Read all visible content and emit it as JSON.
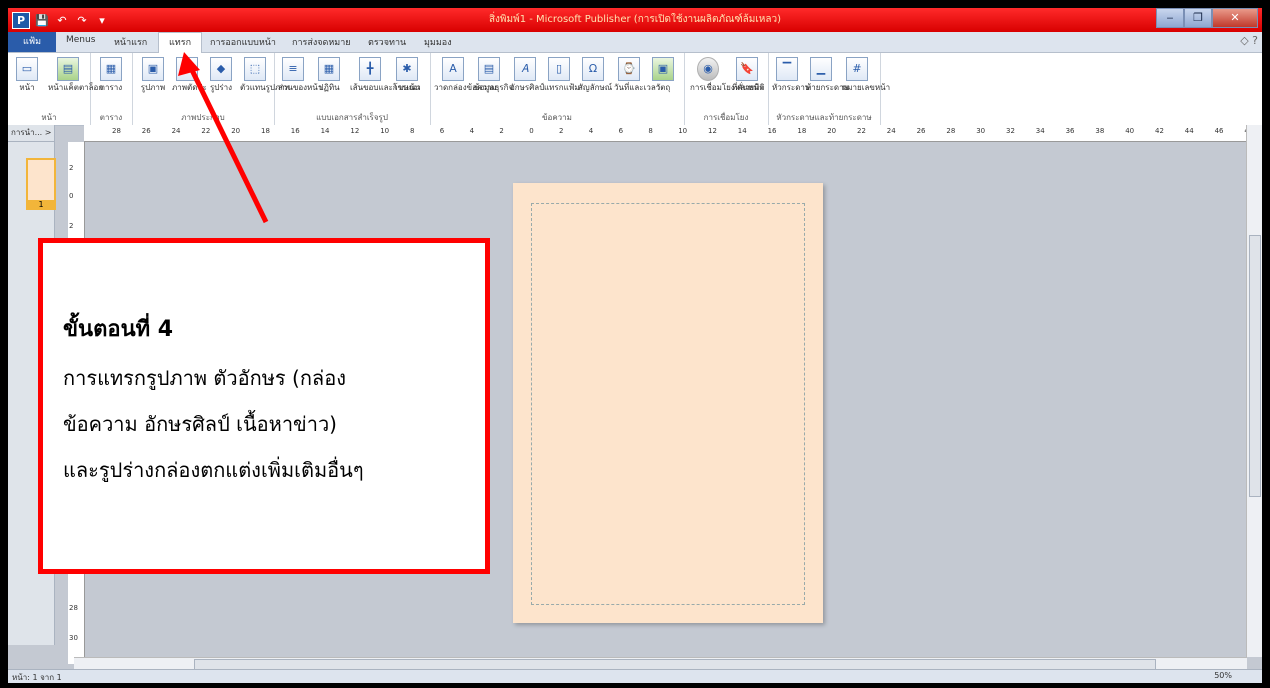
{
  "window": {
    "title": "สิ่งพิมพ์1 - Microsoft Publisher (การเปิดใช้งานผลิตภัณฑ์ล้มเหลว)",
    "minimize_icon": "minimize-icon",
    "maximize_icon": "maximize-icon",
    "close_icon": "close-icon",
    "minimize_label": "‒",
    "maximize_label": "❐",
    "close_label": "✕"
  },
  "quick_access": {
    "app_icon": "P",
    "save": "💾",
    "undo": "↶",
    "redo": "↷",
    "more": "▾"
  },
  "tabs": {
    "file": "แฟ้ม",
    "menus": "Menus",
    "home": "หน้าแรก",
    "insert": "แทรก",
    "page_design": "การออกแบบหน้า",
    "mailings": "การส่งจดหมาย",
    "review": "ตรวจทาน",
    "view": "มุมมอง"
  },
  "ribbon": {
    "groups": {
      "pages": {
        "name": "หน้า",
        "items": {
          "page": "หน้า",
          "catalog": "หน้าแค็ตตาล็อก"
        }
      },
      "tables": {
        "name": "ตาราง",
        "items": {
          "table": "ตาราง"
        }
      },
      "illustrations": {
        "name": "ภาพประกอบ",
        "items": {
          "picture": "รูปภาพ",
          "clipart": "ภาพตัดปะ",
          "shapes": "รูปร่าง",
          "placeholder": "ตัวแทนรูปภาพ"
        }
      },
      "building_blocks": {
        "name": "แบบเอกสารสำเร็จรูป",
        "items": {
          "parts": "ส่วนของหน้า",
          "calendar": "ปฏิทิน",
          "borders": "เส้นขอบและการเน้น",
          "ads": "โฆษณา"
        }
      },
      "text": {
        "name": "ข้อความ",
        "items": {
          "textbox": "วาดกล่องข้อความ",
          "business": "ข้อมูลธุรกิจ",
          "wordart": "อักษรศิลป์",
          "insert_file": "แทรกแฟ้ม",
          "symbol": "สัญลักษณ์",
          "datetime": "วันที่และเวลา",
          "object": "วัตถุ"
        }
      },
      "links": {
        "name": "การเชื่อมโยง",
        "items": {
          "hyperlink": "การเชื่อมโยงหลายมิติ",
          "bookmark": "ที่คั่นหน้า"
        }
      },
      "header_footer": {
        "name": "หัวกระดาษและท้ายกระดาษ",
        "items": {
          "header": "หัวกระดาษ",
          "footer": "ท้ายกระดาษ",
          "page_number": "หมายเลขหน้า"
        }
      }
    }
  },
  "left_panel": {
    "header": "การนำ... >",
    "page_number": "1"
  },
  "rulers": {
    "horizontal_ticks": [
      "28",
      "26",
      "24",
      "22",
      "20",
      "18",
      "16",
      "14",
      "12",
      "10",
      "8",
      "6",
      "4",
      "2",
      "0",
      "2",
      "4",
      "6",
      "8",
      "10",
      "12",
      "14",
      "16",
      "18",
      "20",
      "22",
      "24",
      "26",
      "28",
      "30",
      "32",
      "34",
      "36",
      "38",
      "40",
      "42",
      "44",
      "46",
      "48"
    ],
    "vertical_ticks": [
      "2",
      "0",
      "2",
      "28",
      "30"
    ]
  },
  "status_bar": {
    "page_info": "หน้า: 1 จาก 1",
    "zoom_level": "50%"
  },
  "callout": {
    "heading": "ขั้นตอนที่ 4",
    "body_lines": [
      "การแทรกรูปภาพ ตัวอักษร (กล่อง",
      "ข้อความ อักษรศิลป์ เนื้อหาข่าว)",
      "และรูปร่างกล่องตกแต่งเพิ่มเติมอื่นๆ"
    ]
  },
  "colors": {
    "title_bar": "#e80000",
    "callout_border": "#ff0000",
    "arrow": "#ff0000",
    "page": "#fde4cc",
    "file_tab": "#2a5caa"
  }
}
